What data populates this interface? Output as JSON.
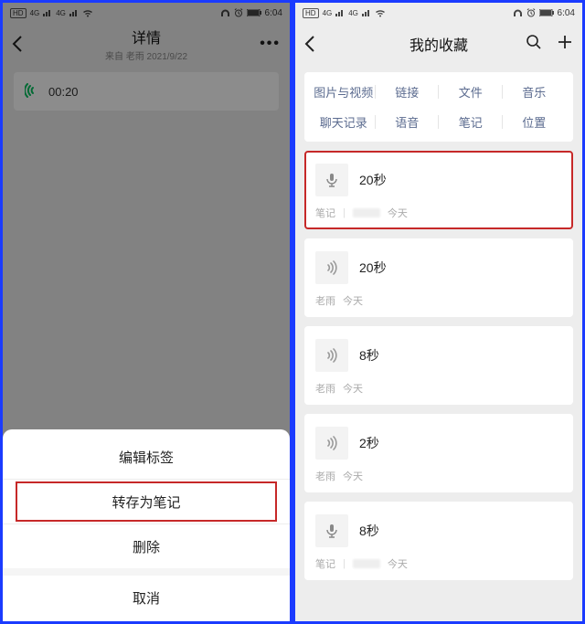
{
  "status": {
    "hd_badge": "HD",
    "net1": "4G",
    "net2": "4G",
    "time": "6:04"
  },
  "left": {
    "title": "详情",
    "subtitle": "来自 老雨 2021/9/22",
    "audio_duration": "00:20",
    "sheet": {
      "edit_tags": "编辑标签",
      "save_as_note": "转存为笔记",
      "delete": "删除",
      "cancel": "取消"
    }
  },
  "right": {
    "title": "我的收藏",
    "chips": {
      "row1": [
        "图片与视频",
        "链接",
        "文件",
        "音乐"
      ],
      "row2": [
        "聊天记录",
        "语音",
        "笔记",
        "位置"
      ]
    },
    "items": [
      {
        "kind": "mic",
        "title": "20秒",
        "source": "笔记",
        "when": "今天",
        "blurred": true
      },
      {
        "kind": "sound",
        "title": "20秒",
        "source": "老雨",
        "when": "今天",
        "blurred": false
      },
      {
        "kind": "sound",
        "title": "8秒",
        "source": "老雨",
        "when": "今天",
        "blurred": false
      },
      {
        "kind": "sound",
        "title": "2秒",
        "source": "老雨",
        "when": "今天",
        "blurred": false
      },
      {
        "kind": "mic",
        "title": "8秒",
        "source": "笔记",
        "when": "今天",
        "blurred": true
      }
    ]
  }
}
